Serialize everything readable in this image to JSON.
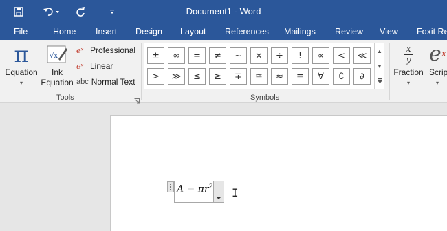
{
  "title": "Document1 - Word",
  "quick_access": {
    "save_icon": "save-icon",
    "undo_icon": "undo-icon",
    "redo_icon": "redo-icon",
    "customize_icon": "customize-qat-icon"
  },
  "tabs": [
    "File",
    "Home",
    "Insert",
    "Design",
    "Layout",
    "References",
    "Mailings",
    "Review",
    "View",
    "Foxit Re"
  ],
  "ribbon": {
    "tools": {
      "label": "Tools",
      "equation": {
        "icon": "π",
        "label": "Equation"
      },
      "ink_equation": {
        "label_line1": "Ink",
        "label_line2": "Equation"
      },
      "professional": "Professional",
      "linear": "Linear",
      "normal_text": "Normal Text",
      "normal_text_icon": "abc"
    },
    "symbols": {
      "label": "Symbols",
      "row1": [
        "±",
        "∞",
        "=",
        "≠",
        "~",
        "×",
        "÷",
        "!",
        "∝",
        "<",
        "≪"
      ],
      "row2": [
        ">",
        "≫",
        "≤",
        "≥",
        "∓",
        "≅",
        "≈",
        "≡",
        "∀",
        "∁",
        "∂"
      ]
    },
    "structures": {
      "fraction": {
        "label": "Fraction",
        "num": "x",
        "den": "y"
      },
      "script": {
        "label": "Scrip",
        "glyph": "e"
      }
    }
  },
  "document": {
    "equation_lhs": "A",
    "equation_eq": " = ",
    "equation_rhs": "πr",
    "equation_exp": "2"
  },
  "colors": {
    "title_bar": "#2b579a",
    "ribbon": "#f1f1f1",
    "canvas": "#e6e6e6"
  }
}
